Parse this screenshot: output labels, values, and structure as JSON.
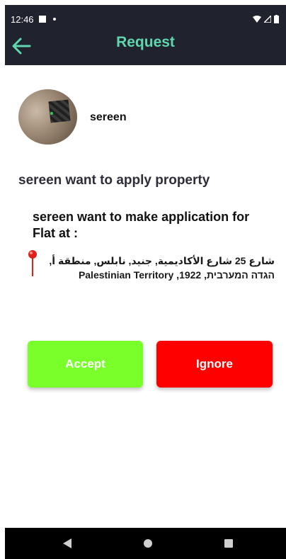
{
  "status_bar": {
    "time": "12:46"
  },
  "app_bar": {
    "title": "Request"
  },
  "profile": {
    "username": "sereen"
  },
  "request": {
    "heading": "sereen want to apply property",
    "subheading": "sereen want to make application for Flat at :",
    "address": "شارع 25 شارع الأكاديمية, جنيد, نابلس, منطقة أ, הגדה המערבית, 1922, Palestinian Territory"
  },
  "actions": {
    "accept_label": "Accept",
    "ignore_label": "Ignore"
  },
  "colors": {
    "app_bar": "#20222e",
    "title": "#5fd6b0",
    "accept": "#79ff2a",
    "ignore": "#ff0000",
    "pin": "#e0201c"
  }
}
